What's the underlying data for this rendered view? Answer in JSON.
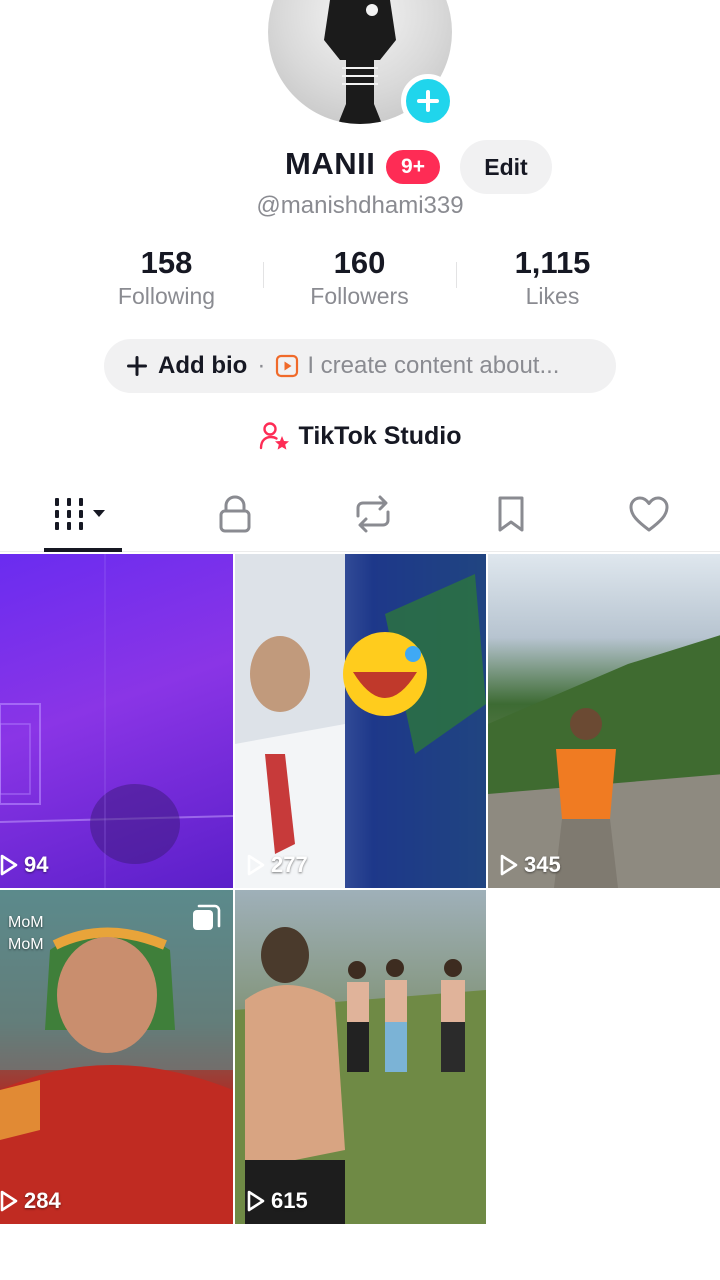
{
  "profile": {
    "display_name": "MANII",
    "notification_badge": "9+",
    "edit_label": "Edit",
    "username": "@manishdhami339"
  },
  "stats": [
    {
      "value": "158",
      "label": "Following"
    },
    {
      "value": "160",
      "label": "Followers"
    },
    {
      "value": "1,115",
      "label": "Likes"
    }
  ],
  "bio": {
    "add_label": "Add bio",
    "separator": "·",
    "placeholder": "I create content about..."
  },
  "studio": {
    "label": "TikTok Studio"
  },
  "tabs": [
    {
      "icon": "videos-grid-icon",
      "active": true
    },
    {
      "icon": "lock-icon",
      "active": false
    },
    {
      "icon": "repost-icon",
      "active": false
    },
    {
      "icon": "bookmark-icon",
      "active": false
    },
    {
      "icon": "heart-icon",
      "active": false
    }
  ],
  "videos": [
    {
      "views": "94"
    },
    {
      "views": "277"
    },
    {
      "views": "345"
    },
    {
      "views": "284",
      "caption": "MoM\nMoM"
    },
    {
      "views": "615"
    }
  ],
  "colors": {
    "accent_pink": "#fe2c55",
    "avatar_plus_cyan": "#20d5ec",
    "text_primary": "#161823",
    "text_secondary": "#8a8b91"
  }
}
